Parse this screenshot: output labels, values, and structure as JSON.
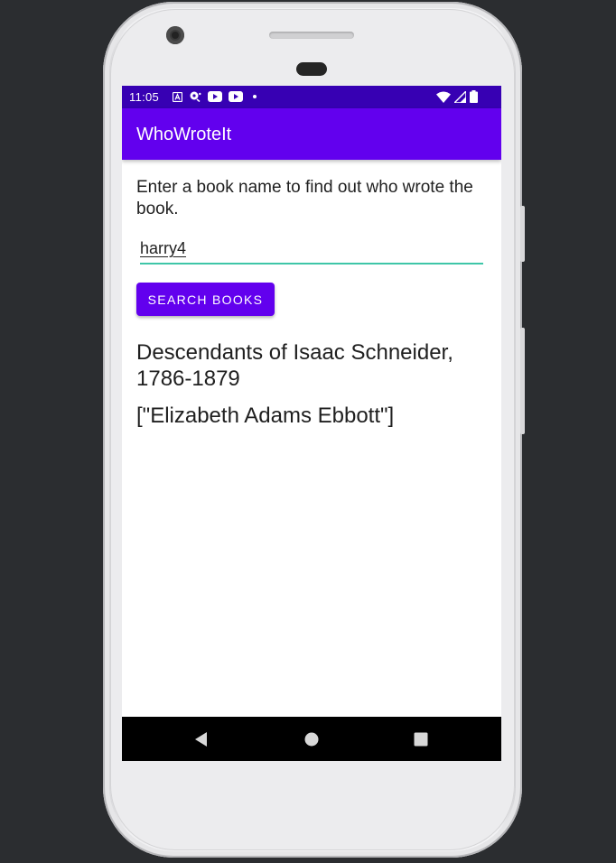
{
  "status_bar": {
    "time": "11:05",
    "left_icons": [
      "text-a-icon",
      "pinwheel-icon",
      "youtube-icon",
      "youtube-icon",
      "dot-icon"
    ],
    "right_icons": [
      "wifi-icon",
      "signal-icon",
      "battery-icon"
    ]
  },
  "app_bar": {
    "title": "WhoWroteIt"
  },
  "main": {
    "prompt": "Enter a book name to find out who wrote the book.",
    "search_input_value": "harry4",
    "search_button_label": "SEARCH BOOKS",
    "result_title": "Descendants of Isaac Schneider, 1786-1879",
    "result_authors": "[\"Elizabeth Adams Ebbott\"]"
  },
  "nav_bar": {
    "buttons": [
      "back-icon",
      "home-icon",
      "recents-icon"
    ]
  },
  "colors": {
    "status_bar": "#3700b3",
    "primary": "#6200ee",
    "accent_underline": "#3ec6a8",
    "nav_bar": "#000000",
    "background": "#2b2d30"
  }
}
